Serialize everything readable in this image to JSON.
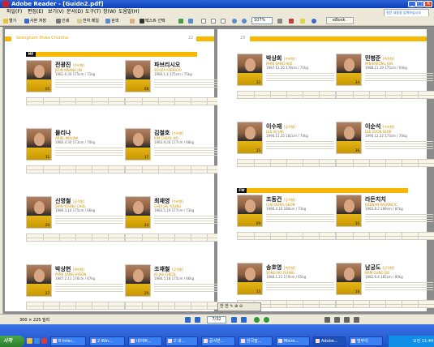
{
  "window": {
    "title": "Adobe Reader - [Guidn2.pdf]"
  },
  "menu": [
    "파일(F)",
    "편집(E)",
    "보기(V)",
    "문서(D)",
    "도구(T)",
    "창(W)",
    "도움말(H)"
  ],
  "help_box": "질문 내용을 입력하십시오",
  "toolbar": {
    "items": [
      "열기",
      "사본 저장",
      "인쇄",
      "전자 메일",
      "검색",
      "텍스트 선택",
      "107%",
      "eBook"
    ],
    "zoom": "107%",
    "ebook": "eBook"
  },
  "pages": {
    "left": {
      "running_head": "Seongnam Ilhwa Chunma",
      "page_no": "22",
      "section": "MF"
    },
    "right": {
      "page_no": "23",
      "section": "FW"
    }
  },
  "players": {
    "left": [
      {
        "name": "전광진",
        "pos": "[수비형]",
        "roman": "JEON KWANG JIN",
        "bio": "1981.6.30  175cm / 71kg",
        "jersey": "05"
      },
      {
        "name": "파브리시오",
        "pos": "",
        "roman": "SOUZA FABRICIO",
        "bio": "1980.1.4  175cm / 75kg",
        "jersey": "08"
      },
      {
        "name": "몰리나",
        "pos": "",
        "roman": "ARIEL MOLINA",
        "bio": "1980.4.30  173cm / 70kg",
        "jersey": "11"
      },
      {
        "name": "김철호",
        "pos": "[수비형]",
        "roman": "KIM CHEOL HO",
        "bio": "1983.9.26  177cm / 68kg",
        "jersey": "17"
      },
      {
        "name": "신영철",
        "pos": "[공격형]",
        "roman": "SHIN YOUNG CHUL",
        "bio": "1986.3.14  175cm / 66kg",
        "jersey": "20"
      },
      {
        "name": "최재영",
        "pos": "[수비형]",
        "roman": "CHOI JAE YOUNG",
        "bio": "1983.5.19  177cm / 73kg",
        "jersey": "24"
      },
      {
        "name": "박상현",
        "pos": "[측면형]",
        "roman": "PARK SANG HYEON",
        "bio": "1987.2.11  176cm / 67kg",
        "jersey": "27"
      },
      {
        "name": "조재철",
        "pos": "[공격형]",
        "roman": "JO JAE CHEOL",
        "bio": "1986.5.18  175cm / 66kg",
        "jersey": "29"
      }
    ],
    "right": [
      {
        "name": "박상희",
        "pos": "[수비형]",
        "roman": "PARK SANG HEE",
        "bio": "1987.12.20  178cm / 71kg",
        "jersey": "32"
      },
      {
        "name": "민병준",
        "pos": "[측면형]",
        "roman": "MIN BYEONG JUN",
        "bio": "1988.11.19  175cm / 64kg",
        "jersey": "34"
      },
      {
        "name": "이수재",
        "pos": "[공격형]",
        "roman": "LEE SU JAE",
        "bio": "1990.11.25  182cm / 74kg",
        "jersey": "35"
      },
      {
        "name": "이순석",
        "pos": "[수비형]",
        "roman": "LEE SOON SEOK",
        "bio": "1990.12.22  173cm / 70kg",
        "jersey": "36"
      },
      {
        "name": "조동건",
        "pos": "[공격형]",
        "roman": "CHO DONG GEON",
        "bio": "1986.4.16  180cm / 73kg",
        "jersey": "09"
      },
      {
        "name": "라돈치치",
        "pos": "",
        "roman": "DZENAN RADONCIC",
        "bio": "1983.8.2  189cm / 87kg",
        "jersey": "10"
      },
      {
        "name": "송호영",
        "pos": "[측면형]",
        "roman": "SONG HO YOUNG",
        "bio": "1988.1.21  170cm / 65kg",
        "jersey": "13"
      },
      {
        "name": "남궁도",
        "pos": "[공격형]",
        "roman": "NAM GUNG DO",
        "bio": "1982.6.4  185cm / 80kg",
        "jersey": "18"
      }
    ]
  },
  "status": {
    "page_size": "300 × 225 밀리",
    "page_field": "7/32"
  },
  "floatbar": "한 한 ✎ ⊕ ⊖",
  "taskbar": {
    "start": "시작",
    "tasks": [
      "8 Inter...",
      "2 Win...",
      "네이버...",
      "2 내...",
      "공사반...",
      "한국말...",
      "Micro...",
      "Adobe...",
      "범주이"
    ],
    "clock": "오전 11:44"
  },
  "colors": {
    "accent_yellow": "#f6b800",
    "title_blue": "#0a3fb8",
    "taskbar_blue": "#1f4fc9"
  }
}
